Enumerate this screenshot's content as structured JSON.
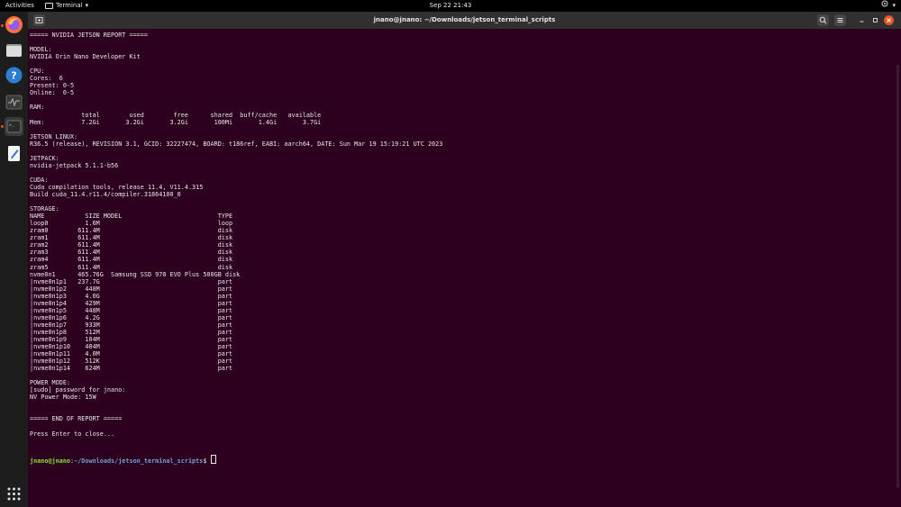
{
  "topbar": {
    "activities": "Activities",
    "app_name": "Terminal",
    "clock": "Sep 22  21:43"
  },
  "window": {
    "title": "jnano@jnano: ~/Downloads/jetson_terminal_scripts"
  },
  "terminal": {
    "output": "===== NVIDIA JETSON REPORT =====\n\nMODEL:\nNVIDIA Orin Nano Developer Kit\n\nCPU:\nCores:  6\nPresent: 0-5\nOnline:  0-5\n\nRAM:\n              total        used        free      shared  buff/cache   available\nMem:          7.2Gi       3.2Gi       3.2Gi       100Mi       1.4Gi       3.7Gi\n\nJETSON LINUX:\nR36.5 (release), REVISION 3.1, GCID: 32227474, BOARD: t186ref, EABI: aarch64, DATE: Sun Mar 19 15:19:21 UTC 2023\n\nJETPACK:\nnvidia-jetpack 5.1.1-b56\n\nCUDA:\nCuda compilation tools, release 11.4, V11.4.315\nBuild cuda_11.4.r11.4/compiler.31864100_0\n\nSTORAGE:\nNAME           SIZE MODEL                          TYPE\nloop0          1.6M                                loop\nzram0        611.4M                                disk\nzram1        611.4M                                disk\nzram2        611.4M                                disk\nzram3        611.4M                                disk\nzram4        611.4M                                disk\nzram5        611.4M                                disk\nnvme0n1      465.76G  Samsung SSD 970 EVO Plus 500GB disk\n|nvme0n1p1   237.7G                                part\n|nvme0n1p2     448M                                part\n|nvme0n1p3     4.0G                                part\n|nvme0n1p4     429M                                part\n|nvme0n1p5     448M                                part\n|nvme0n1p6     4.2G                                part\n|nvme0n1p7     933M                                part\n|nvme0n1p8     512M                                part\n|nvme0n1p9     104M                                part\n|nvme0n1p10    404M                                part\n|nvme0n1p11    4.0M                                part\n|nvme0n1p12    512K                                part\n|nvme0n1p14    624M                                part\n\nPOWER MODE:\n[sudo] password for jnano:\nNV Power Mode: 15W\n\n\n===== END OF REPORT =====\n\nPress Enter to close...",
    "prompt_user": "jnano@jnano",
    "prompt_sep": ":",
    "prompt_path": "~/Downloads/jetson_terminal_scripts",
    "prompt_end": "$ "
  },
  "icons": {
    "dock": [
      "firefox-icon",
      "files-icon",
      "help-icon",
      "system-monitor-icon",
      "terminal-icon",
      "text-editor-icon",
      "app-grid-icon"
    ],
    "header": [
      "new-tab-icon",
      "search-icon",
      "menu-icon",
      "minimize-icon",
      "maximize-icon",
      "close-icon"
    ]
  },
  "colors": {
    "terminal_bg": "#2c001e",
    "accent": "#e95420",
    "prompt_user": "#8ae234",
    "prompt_path": "#729fcf"
  }
}
